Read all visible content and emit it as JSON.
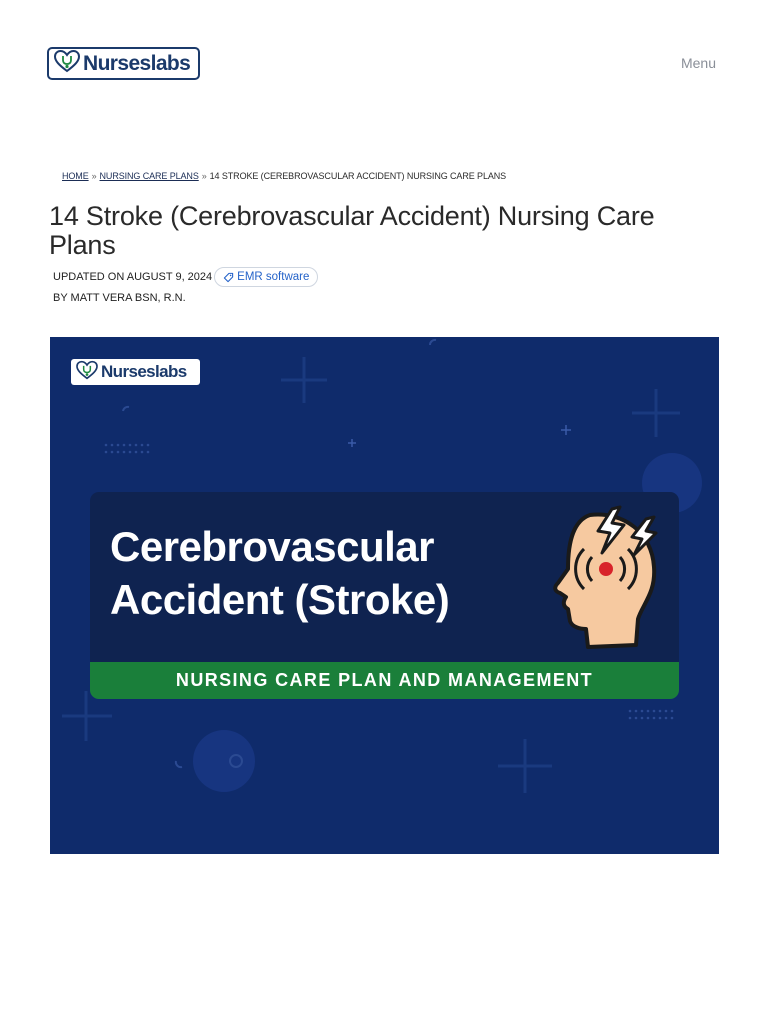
{
  "header": {
    "logo_text": "Nurseslabs",
    "menu_label": "Menu"
  },
  "breadcrumb": {
    "home": "HOME",
    "separator": "»",
    "category": "NURSING CARE PLANS",
    "current": "14 STROKE (CEREBROVASCULAR ACCIDENT) NURSING CARE PLANS"
  },
  "article": {
    "title": "14 Stroke (Cerebrovascular Accident) Nursing Care Plans",
    "updated": "UPDATED ON AUGUST 9, 2024",
    "tag": "EMR software",
    "byline": "BY MATT VERA BSN, R.N."
  },
  "hero": {
    "logo_text": "Nurseslabs",
    "heading": "Cerebrovascular\nAccident (Stroke)",
    "banner": "NURSING CARE PLAN AND MANAGEMENT",
    "colors": {
      "background": "#0f2b6b",
      "card": "#0f2350",
      "banner": "#1a7f3a"
    }
  }
}
